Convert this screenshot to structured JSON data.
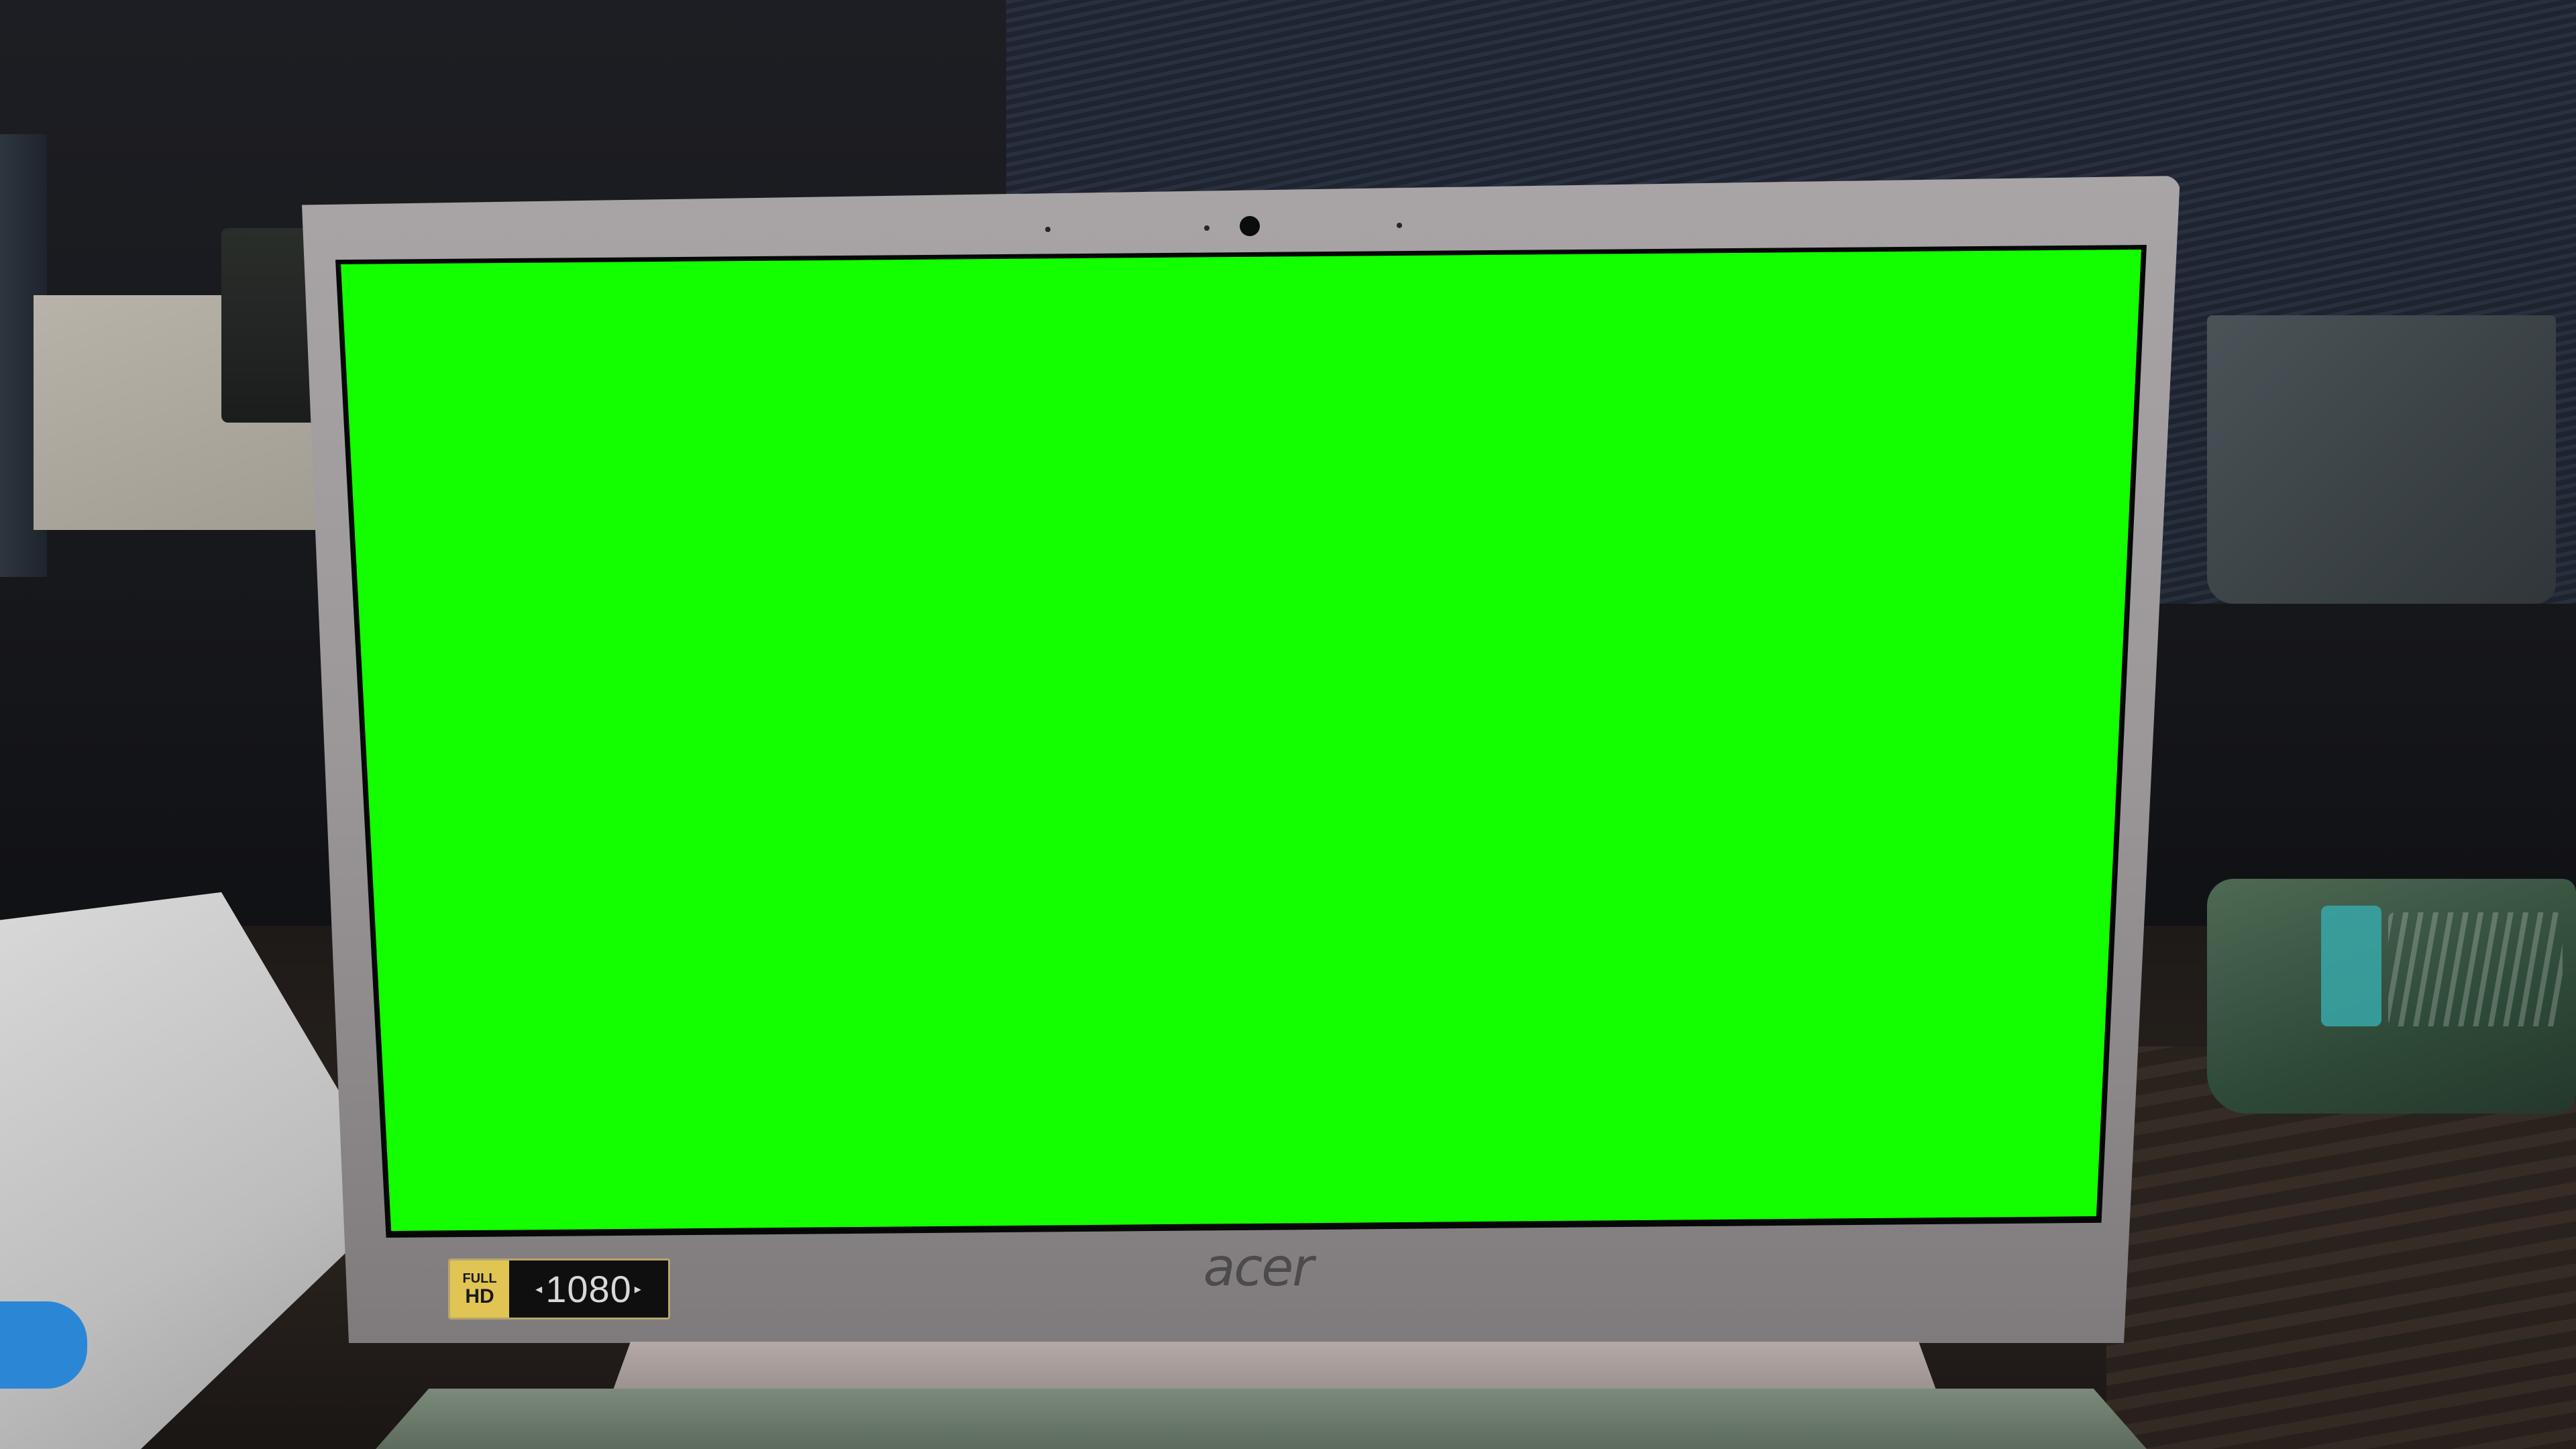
{
  "scene": {
    "description_label": "",
    "screen_color": "#13ff00",
    "laptop": {
      "brand": "acer",
      "badge": {
        "line1": "FULL",
        "line2": "HD",
        "resolution": "1080"
      }
    }
  }
}
